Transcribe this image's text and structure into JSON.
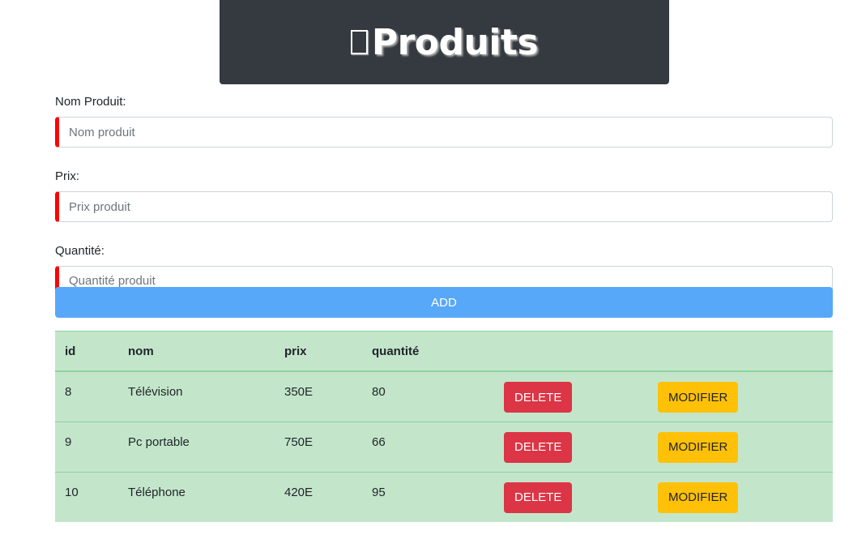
{
  "header": {
    "title": "Produits",
    "icon": "missing-glyph-icon"
  },
  "form": {
    "name_label": "Nom Produit:",
    "name_placeholder": "Nom produit",
    "price_label": "Prix:",
    "price_placeholder": "Prix produit",
    "quantity_label": "Quantité:",
    "quantity_placeholder": "Quantité produit",
    "add_label": "ADD"
  },
  "table": {
    "headers": {
      "id": "id",
      "nom": "nom",
      "prix": "prix",
      "quantite": "quantité"
    },
    "rows": [
      {
        "id": "8",
        "nom": "Télévision",
        "prix": "350E",
        "quantite": "80",
        "delete_label": "DELETE",
        "modify_label": "MODIFIER"
      },
      {
        "id": "9",
        "nom": "Pc portable",
        "prix": "750E",
        "quantite": "66",
        "delete_label": "DELETE",
        "modify_label": "MODIFIER"
      },
      {
        "id": "10",
        "nom": "Téléphone",
        "prix": "420E",
        "quantite": "95",
        "delete_label": "DELETE",
        "modify_label": "MODIFIER"
      }
    ]
  },
  "colors": {
    "header_bg": "#343a40",
    "input_accent": "#ff0000",
    "add_button": "#58a8fa",
    "table_bg": "#c3e6cb",
    "delete_button": "#dc3545",
    "modify_button": "#ffc107"
  }
}
